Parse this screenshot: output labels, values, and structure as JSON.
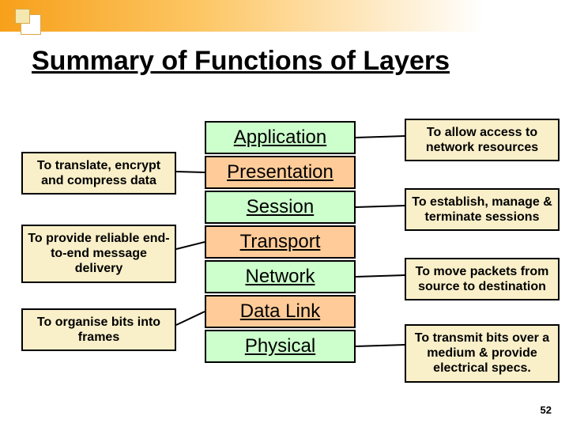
{
  "title": "Summary of Functions of Layers",
  "layers": [
    "Application",
    "Presentation",
    "Session",
    "Transport",
    "Network",
    "Data Link",
    "Physical"
  ],
  "left_notes": [
    "To translate, encrypt and compress data",
    "To provide reliable end-to-end message delivery",
    "To organise bits into frames"
  ],
  "right_notes": [
    "To allow access to network resources",
    "To establish, manage &  terminate sessions",
    "To move packets from source to destination",
    "To transmit bits over a medium & provide electrical specs."
  ],
  "page_number": "52"
}
